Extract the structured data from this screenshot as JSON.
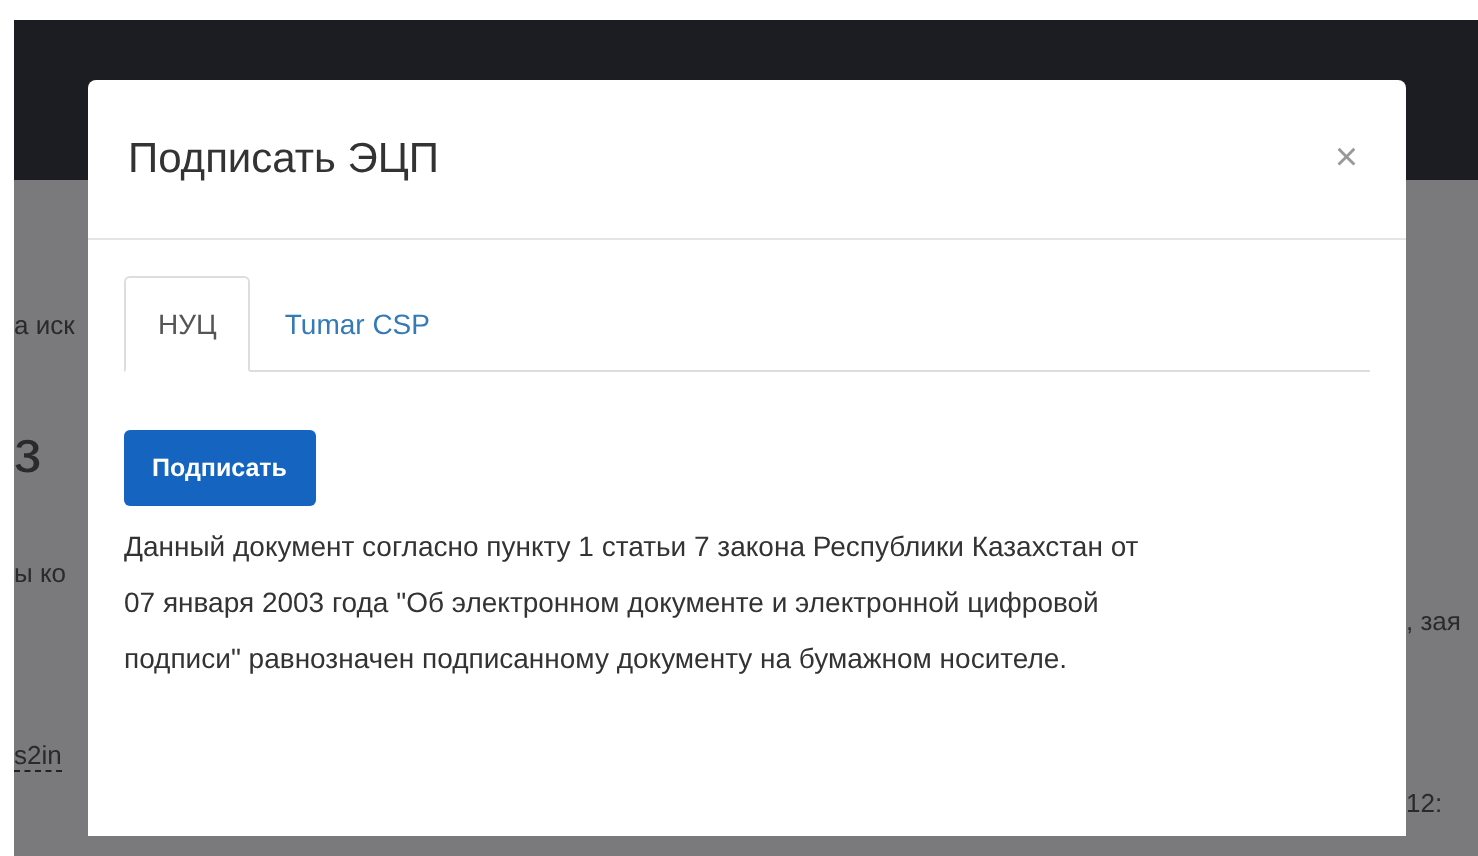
{
  "background": {
    "left_texts": [
      {
        "text": "а иск",
        "kind": "small"
      },
      {
        "text": "з",
        "kind": "heading"
      },
      {
        "text": "ы ко",
        "kind": "small"
      },
      {
        "text": "s2in",
        "kind": "link"
      }
    ],
    "right_texts": [
      ", зая",
      "12:"
    ]
  },
  "modal": {
    "title": "Подписать ЭЦП",
    "close": "×",
    "tabs": [
      {
        "label": "НУЦ",
        "selected": true
      },
      {
        "label": "Tumar CSP",
        "selected": false
      }
    ],
    "button": "Подписать",
    "text": "Данный документ согласно пункту 1 статьи 7 закона Республики Казахстан от 07 января 2003 года \"Об электронном документе и электронной цифровой подписи\" равнозначен подписанному документу на бумажном носителе."
  }
}
